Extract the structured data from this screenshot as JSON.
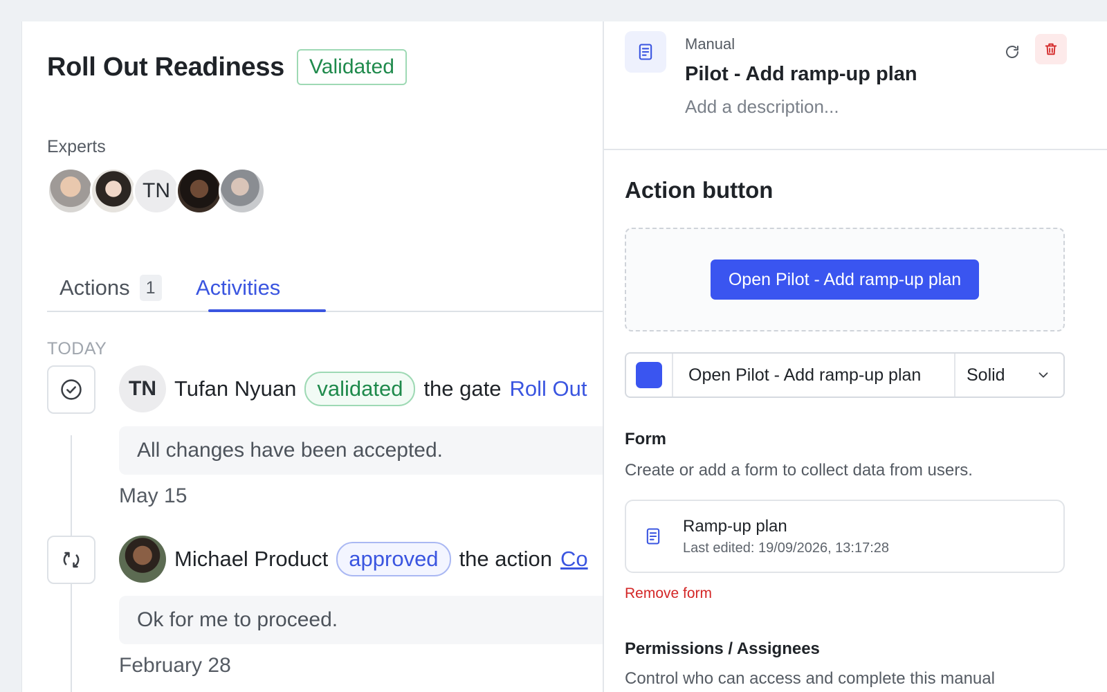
{
  "gate": {
    "title": "Roll Out Readiness",
    "status": "Validated",
    "experts_label": "Experts",
    "experts": [
      {
        "initials": ""
      },
      {
        "initials": ""
      },
      {
        "initials": "TN"
      },
      {
        "initials": ""
      },
      {
        "initials": ""
      }
    ]
  },
  "tabs": [
    {
      "label": "Actions",
      "count": "1",
      "active": false
    },
    {
      "label": "Activities",
      "active": true
    }
  ],
  "activity": {
    "group_label": "TODAY",
    "items": [
      {
        "icon": "check-circle-icon",
        "avatar_initials": "TN",
        "user": "Tufan Nyuan",
        "verb": "validated",
        "text": "the gate",
        "target": "Roll Out",
        "comment": "All changes have been accepted.",
        "date": "May 15"
      },
      {
        "icon": "refresh-icon",
        "avatar_initials": "",
        "user": "Michael Product",
        "verb": "approved",
        "text": "the action",
        "target": "Co",
        "comment": "Ok for me to proceed.",
        "date": "February 28"
      }
    ]
  },
  "panel": {
    "kind": "Manual",
    "title": "Pilot - Add ramp-up plan",
    "description_placeholder": "Add a description...",
    "action_button": {
      "section_title": "Action button",
      "preview_label": "Open Pilot - Add ramp-up plan",
      "color": "#3a55f0",
      "label_value": "Open Pilot - Add ramp-up plan",
      "style": "Solid"
    },
    "form": {
      "label": "Form",
      "description": "Create or add a form to collect data from users.",
      "name": "Ramp-up plan",
      "last_edited": "Last edited: 19/09/2026, 13:17:28",
      "remove_label": "Remove form"
    },
    "permissions": {
      "label": "Permissions / Assignees",
      "description": "Control who can access and complete this manual"
    }
  },
  "colors": {
    "accent": "#3a55e0",
    "success": "#1f8a4c",
    "danger": "#d32626"
  }
}
